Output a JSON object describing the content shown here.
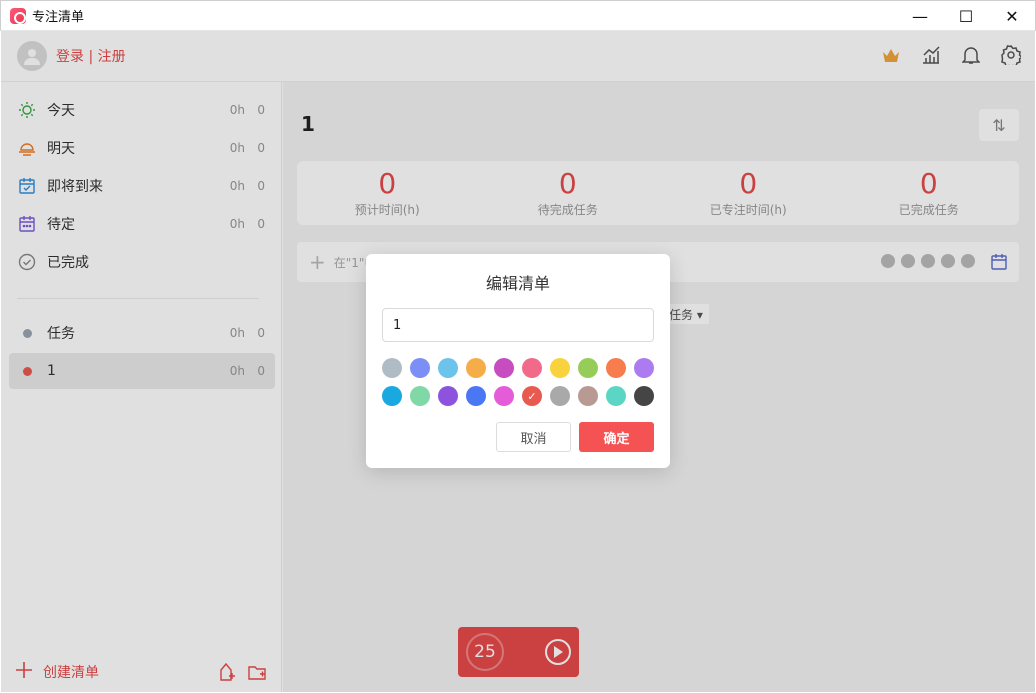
{
  "app": {
    "title": "专注清单"
  },
  "window": {
    "minimize": "—",
    "maximize": "☐",
    "close": "✕"
  },
  "header": {
    "login": "登录 | 注册"
  },
  "sidebar": {
    "smart_lists": [
      {
        "label": "今天",
        "hours": "0h",
        "count": "0",
        "icon": "sun-icon",
        "color": "#3aa845"
      },
      {
        "label": "明天",
        "hours": "0h",
        "count": "0",
        "icon": "sunset-icon",
        "color": "#f07d28"
      },
      {
        "label": "即将到来",
        "hours": "0h",
        "count": "0",
        "icon": "calendar-icon",
        "color": "#2f8fe0"
      },
      {
        "label": "待定",
        "hours": "0h",
        "count": "0",
        "icon": "calendar-pending-icon",
        "color": "#7d5ae0"
      },
      {
        "label": "已完成",
        "hours": "",
        "count": "",
        "icon": "check-circle-icon",
        "color": "#888888"
      }
    ],
    "lists": [
      {
        "label": "任务",
        "hours": "0h",
        "count": "0",
        "color": "#9aa6b2"
      },
      {
        "label": "1",
        "hours": "0h",
        "count": "0",
        "color": "#e85a4f"
      }
    ],
    "create_list": "创建清单"
  },
  "main": {
    "title": "1",
    "sort_icon": "⇅",
    "stats": [
      {
        "value": "0",
        "label": "预计时间(h)"
      },
      {
        "value": "0",
        "label": "待完成任务"
      },
      {
        "value": "0",
        "label": "已专注时间(h)"
      },
      {
        "value": "0",
        "label": "已完成任务"
      }
    ],
    "add_task": "在\"1\"中",
    "filter": "任务 ▾"
  },
  "timer": {
    "minutes": "25"
  },
  "modal": {
    "title": "编辑清单",
    "input_value": "1",
    "colors": [
      "#b0bcc5",
      "#7b8ff7",
      "#6cc3ec",
      "#f5ad4a",
      "#c74cc0",
      "#f16a8a",
      "#f9d33e",
      "#96cc58",
      "#f87d4e",
      "#ad7bf0",
      "#1aa8e0",
      "#7fd8a6",
      "#8d53de",
      "#4a78f5",
      "#e55cd8",
      "#e85a4f",
      "#a9a9a9",
      "#b89a92",
      "#5cd6c4",
      "#454545"
    ],
    "selected_index": 15,
    "cancel": "取消",
    "confirm": "确定"
  }
}
